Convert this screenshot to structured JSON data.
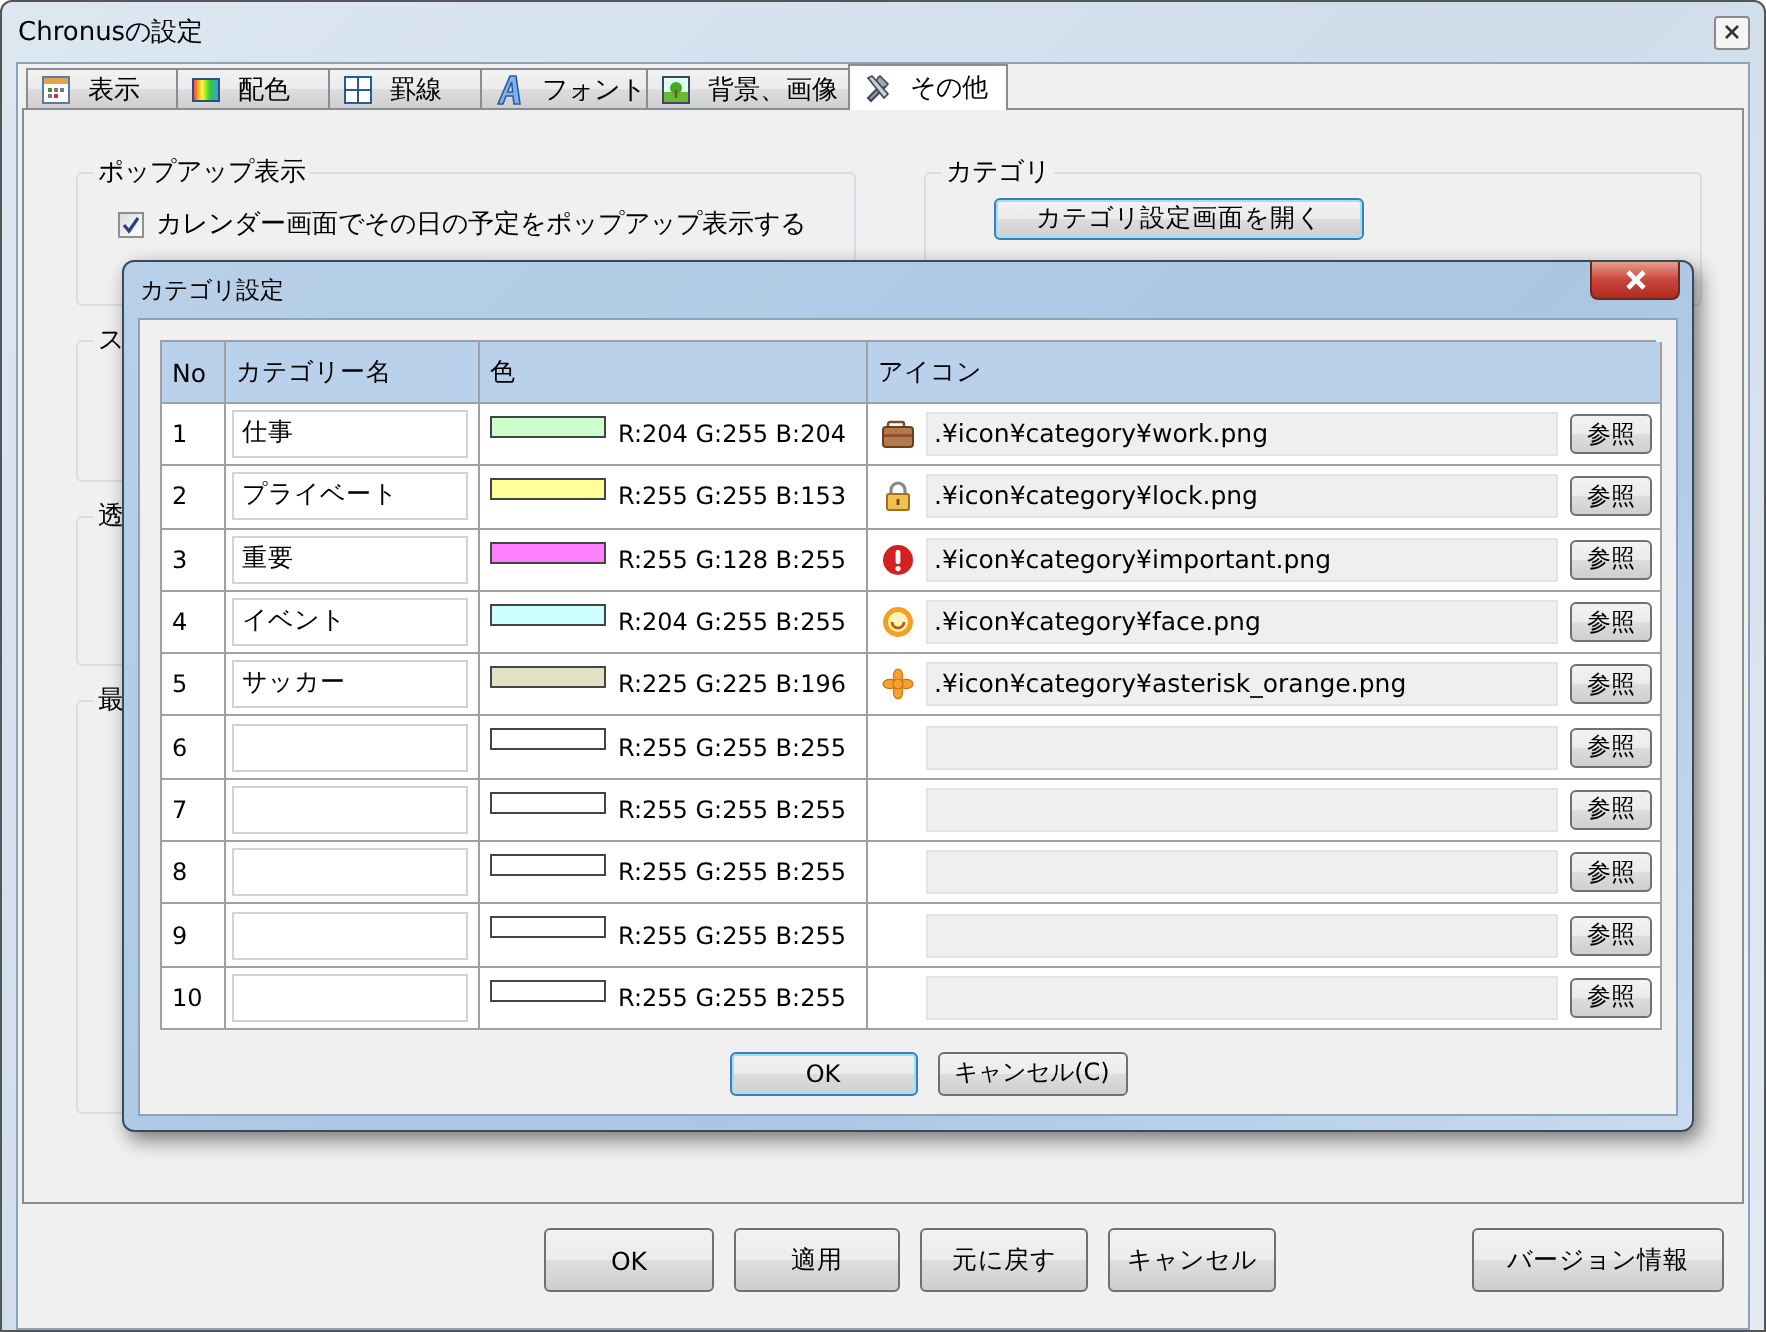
{
  "window": {
    "title": "Chronusの設定"
  },
  "tabs": [
    {
      "label": "表示",
      "kind": "calendar",
      "selected": false
    },
    {
      "label": "配色",
      "kind": "palette",
      "selected": false
    },
    {
      "label": "罫線",
      "kind": "grid",
      "selected": false
    },
    {
      "label": "フォント",
      "kind": "letter",
      "selected": false
    },
    {
      "label": "背景、画像",
      "kind": "image",
      "selected": false
    },
    {
      "label": "その他",
      "kind": "tools",
      "selected": true
    }
  ],
  "popup_group": {
    "title": "ポップアップ表示",
    "checkbox": {
      "label": "カレンダー画面でその日の予定をポップアップ表示する",
      "checked": true
    }
  },
  "partial_groups": [
    {
      "title": "ス"
    },
    {
      "title": "透"
    },
    {
      "title": "最"
    }
  ],
  "category_group": {
    "title": "カテゴリ",
    "button": "カテゴリ設定画面を開く"
  },
  "dialog": {
    "title": "カテゴリ設定",
    "columns": [
      "No",
      "カテゴリー名",
      "色",
      "アイコン"
    ],
    "rows": [
      {
        "no": "1",
        "name": "仕事",
        "color": "#ccffcc",
        "rgb": "R:204 G:255 B:204",
        "kind": "briefcase",
        "path": ".¥icon¥category¥work.png",
        "browse": "参照"
      },
      {
        "no": "2",
        "name": "プライベート",
        "color": "#ffff99",
        "rgb": "R:255 G:255 B:153",
        "kind": "lock",
        "path": ".¥icon¥category¥lock.png",
        "browse": "参照"
      },
      {
        "no": "3",
        "name": "重要",
        "color": "#ff80ff",
        "rgb": "R:255 G:128 B:255",
        "kind": "alert",
        "path": ".¥icon¥category¥important.png",
        "browse": "参照"
      },
      {
        "no": "4",
        "name": "イベント",
        "color": "#ccffff",
        "rgb": "R:204 G:255 B:255",
        "kind": "face",
        "path": ".¥icon¥category¥face.png",
        "browse": "参照"
      },
      {
        "no": "5",
        "name": "サッカー",
        "color": "#e1e1c4",
        "rgb": "R:225 G:225 B:196",
        "kind": "asterisk",
        "path": ".¥icon¥category¥asterisk_orange.png",
        "browse": "参照"
      },
      {
        "no": "6",
        "color": "#ffffff",
        "rgb": "R:255 G:255 B:255",
        "browse": "参照"
      },
      {
        "no": "7",
        "color": "#ffffff",
        "rgb": "R:255 G:255 B:255",
        "browse": "参照"
      },
      {
        "no": "8",
        "color": "#ffffff",
        "rgb": "R:255 G:255 B:255",
        "browse": "参照"
      },
      {
        "no": "9",
        "color": "#ffffff",
        "rgb": "R:255 G:255 B:255",
        "browse": "参照"
      },
      {
        "no": "10",
        "color": "#ffffff",
        "rgb": "R:255 G:255 B:255",
        "browse": "参照"
      }
    ],
    "buttons": [
      "OK",
      "キャンセル(C)"
    ]
  },
  "buttons": [
    "OK",
    "適用",
    "元に戻す",
    "キャンセル"
  ],
  "version_button": "バージョン情報"
}
